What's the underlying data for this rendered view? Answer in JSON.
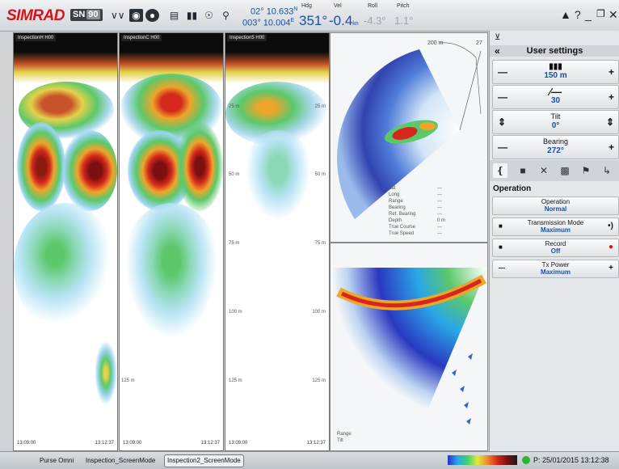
{
  "brand": "SIMRAD",
  "model": "SN",
  "model_sub": "90",
  "topbar": {
    "icons": [
      "chevron-down-double-icon",
      "camera-icon",
      "record-icon",
      "echogram-icon",
      "bar-chart-icon",
      "compass-icon",
      "search-icon"
    ],
    "position_lat": "02° 10.633",
    "position_lon": "003° 10.004",
    "pos_unit_lat": "N",
    "pos_unit_lon": "E",
    "hdg_label": "Hdg",
    "hdg_value": "351°",
    "vel_label": "Vel",
    "vel_value": "-0.4",
    "vel_unit": "kn",
    "roll_label": "Roll",
    "roll_value": "-4.3°",
    "pitch_label": "Pitch",
    "pitch_value": "1.1°",
    "right_icons": [
      "alert-icon",
      "help-icon",
      "minimize-icon",
      "restore-icon",
      "close-icon"
    ]
  },
  "panels": [
    {
      "title": "InspectionH H00",
      "start": "13:09:00",
      "end": "13:12:37"
    },
    {
      "title": "InspectionC H00",
      "start": "13:09:00",
      "end": "13:12:37"
    },
    {
      "title": "Inspection5 H00",
      "start": "13:09:00",
      "end": "13:12:37"
    }
  ],
  "depths": [
    "25 m",
    "50 m",
    "75 m",
    "100 m",
    "125 m"
  ],
  "sonar_top": {
    "scale_left": "200 m",
    "scale_right": "27",
    "info_labels": [
      "Lat",
      "Long",
      "Range",
      "Bearing",
      "Ref. Bearing",
      "Depth",
      "True Course",
      "True Speed"
    ],
    "info_values": [
      "---",
      "---",
      "---",
      "---",
      "---",
      "0 m",
      "---",
      "---"
    ]
  },
  "sonar_bottom": {
    "info": [
      "Range",
      "Tilt"
    ]
  },
  "right_panel": {
    "top_icon": "pin-icon",
    "back": "«",
    "title": "User settings",
    "controls": [
      {
        "name": "range",
        "label": "",
        "value": "150 m",
        "icon": "range-icon"
      },
      {
        "name": "gain",
        "label": "",
        "value": "30",
        "icon": "gain-icon"
      },
      {
        "name": "tilt",
        "label": "Tilt",
        "value": "0°"
      },
      {
        "name": "bearing",
        "label": "Bearing",
        "value": "272°"
      }
    ],
    "tabs": [
      "sonar-beam-icon",
      "display-icon",
      "tools-icon",
      "settings-icon",
      "flag-icon",
      "more-icon"
    ],
    "operation_title": "Operation",
    "operations": [
      {
        "label": "Operation",
        "value": "Normal",
        "l": "",
        "r": ""
      },
      {
        "label": "Transmission Mode",
        "value": "Maximum",
        "l": "■",
        "r": "•)"
      },
      {
        "label": "Record",
        "value": "Off",
        "l": "■",
        "r": "●"
      },
      {
        "label": "Tx Power",
        "value": "Maximum",
        "l": "—",
        "r": "+"
      }
    ]
  },
  "bottombar": {
    "tabs": [
      "Purse Omni",
      "Inspection_ScreenMode",
      "Inspection2_ScreenMode"
    ],
    "active_tab": 2,
    "status_text": "P: 25/01/2015  13:12:38",
    "colors": {
      "status_ok": "#2bb536"
    }
  }
}
